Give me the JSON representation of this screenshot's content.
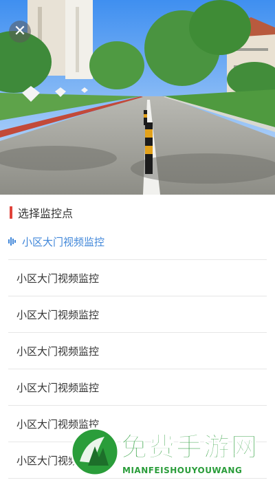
{
  "player": {
    "close_icon": "close-icon"
  },
  "section": {
    "title": "选择监控点"
  },
  "monitors": [
    {
      "label": "小区大门视频监控",
      "active": true
    },
    {
      "label": "小区大门视频监控",
      "active": false
    },
    {
      "label": "小区大门视频监控",
      "active": false
    },
    {
      "label": "小区大门视频监控",
      "active": false
    },
    {
      "label": "小区大门视频监控",
      "active": false
    },
    {
      "label": "小区大门视频监控",
      "active": false
    },
    {
      "label": "小区大门视频监控",
      "active": false
    }
  ],
  "watermark": {
    "title": "免费手游网",
    "subtitle": "MIANFEISHOUYOUWANG"
  },
  "colors": {
    "accent": "#3f86d9",
    "section_bar": "#e0433a",
    "watermark_green": "#2a9d3a"
  }
}
